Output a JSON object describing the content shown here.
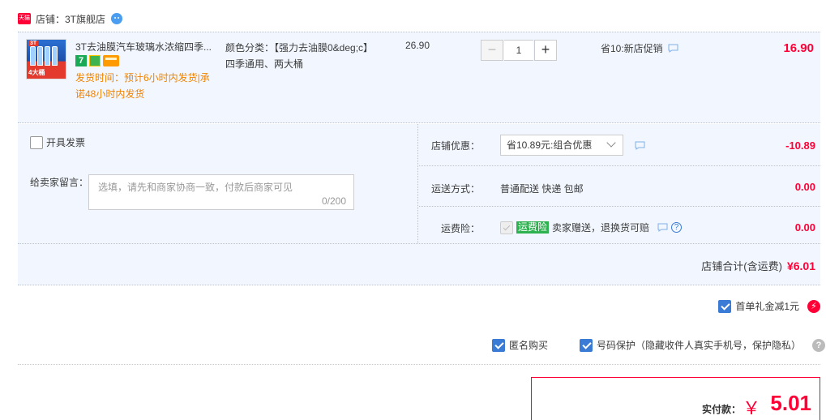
{
  "shop": {
    "badge": "天猫",
    "name": "店铺：3T旗舰店"
  },
  "item": {
    "thumb_brand": "3T",
    "thumb_tag": "4大桶",
    "title": "3T去油膜汽车玻璃水浓缩四季...",
    "badge_seven": "7",
    "ship_time": "发货时间：预计6小时内发货|承诺48小时内发货",
    "sku": "颜色分类：【强力去油膜0&deg;c】四季通用、两大桶",
    "unit_price": "26.90",
    "quantity": "1",
    "qty_minus": "−",
    "qty_plus": "+",
    "promo": "省10:新店促销",
    "total": "16.90"
  },
  "extras": {
    "invoice_label": "开具发票",
    "message_label": "给卖家留言：",
    "message_placeholder": "选填，请先和商家协商一致，付款后商家可见",
    "message_count": "0/200",
    "discount_label": "店铺优惠：",
    "discount_option": "省10.89元:组合优惠",
    "discount_amount": "-10.89",
    "shipping_label": "运送方式：",
    "shipping_value": "普通配送 快递 包邮",
    "shipping_amount": "0.00",
    "insurance_label": "运费险：",
    "insurance_tag": "运费险",
    "insurance_text": "卖家赠送，退换货可赔",
    "insurance_amount": "0.00",
    "help_mark": "?"
  },
  "shop_total": {
    "label": "店铺合计(含运费)",
    "amount": "¥6.01"
  },
  "options": {
    "gift": "首单礼金减1元",
    "gift_icon": "⚡",
    "anonymous": "匿名购买",
    "privacy": "号码保护（隐藏收件人真实手机号，保护隐私）",
    "help": "?"
  },
  "payment": {
    "label": "实付款：",
    "currency": "￥",
    "amount": "5.01"
  },
  "colors": {
    "accent": "#ff0036",
    "row_bg": "#f2f7ff",
    "orange": "#f08300",
    "check_blue": "#3a7bd5"
  }
}
